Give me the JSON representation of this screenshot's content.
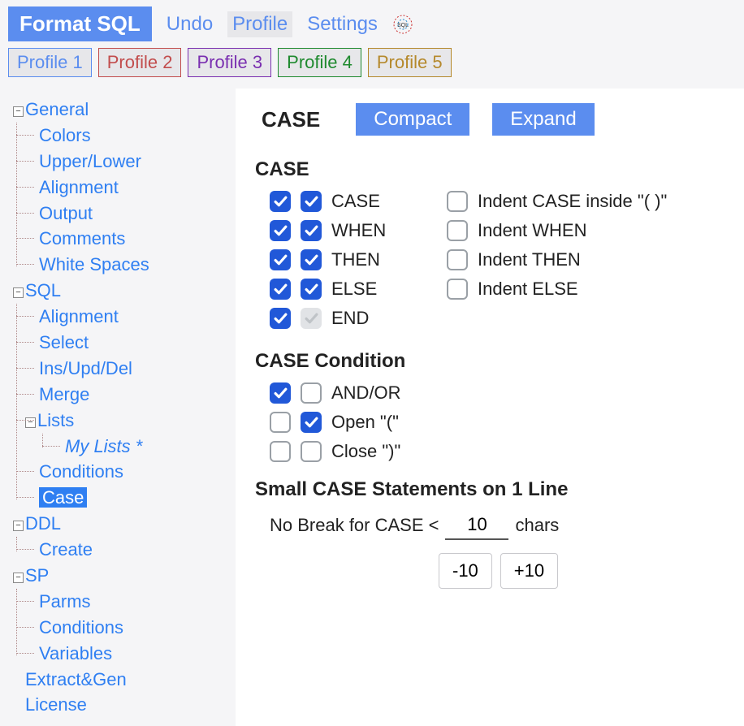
{
  "toolbar": {
    "format_label": "Format SQL",
    "undo_label": "Undo",
    "profile_label": "Profile",
    "settings_label": "Settings"
  },
  "profiles": [
    {
      "label": "Profile 1",
      "color": "#5b8def"
    },
    {
      "label": "Profile 2",
      "color": "#c24d4d"
    },
    {
      "label": "Profile 3",
      "color": "#7a2fb0"
    },
    {
      "label": "Profile 4",
      "color": "#1f8a2f"
    },
    {
      "label": "Profile 5",
      "color": "#b5892c"
    }
  ],
  "tree": {
    "general": "General",
    "general_children": {
      "colors": "Colors",
      "upperlower": "Upper/Lower",
      "alignment": "Alignment",
      "output": "Output",
      "comments": "Comments",
      "whitespaces": "White Spaces"
    },
    "sql": "SQL",
    "sql_children": {
      "alignment": "Alignment",
      "select": "Select",
      "iud": "Ins/Upd/Del",
      "merge": "Merge",
      "lists": "Lists",
      "mylists": "My Lists *",
      "conditions": "Conditions",
      "case": "Case"
    },
    "ddl": "DDL",
    "ddl_children": {
      "create": "Create"
    },
    "sp": "SP",
    "sp_children": {
      "parms": "Parms",
      "conditions": "Conditions",
      "variables": "Variables"
    },
    "extractgen": "Extract&Gen",
    "license": "License"
  },
  "page": {
    "title": "CASE",
    "compact": "Compact",
    "expand": "Expand"
  },
  "case_section": {
    "heading": "CASE",
    "rows": [
      {
        "label": "CASE",
        "c1": true,
        "c2": true,
        "right_label": "Indent CASE inside \"( )\"",
        "right_checked": false
      },
      {
        "label": "WHEN",
        "c1": true,
        "c2": true,
        "right_label": "Indent WHEN",
        "right_checked": false
      },
      {
        "label": "THEN",
        "c1": true,
        "c2": true,
        "right_label": "Indent THEN",
        "right_checked": false
      },
      {
        "label": "ELSE",
        "c1": true,
        "c2": true,
        "right_label": "Indent ELSE",
        "right_checked": false
      },
      {
        "label": "END",
        "c1": true,
        "c2": "disabled"
      }
    ]
  },
  "cond_section": {
    "heading": "CASE Condition",
    "rows": [
      {
        "label": "AND/OR",
        "c1": true,
        "c2": false
      },
      {
        "label": "Open \"(\"",
        "c1": false,
        "c2": true
      },
      {
        "label": "Close \")\"",
        "c1": false,
        "c2": false
      }
    ]
  },
  "small_case": {
    "heading": "Small CASE Statements on 1 Line",
    "prefix": "No Break for  CASE <",
    "value": "10",
    "suffix": "chars",
    "minus": "-10",
    "plus": "+10"
  }
}
